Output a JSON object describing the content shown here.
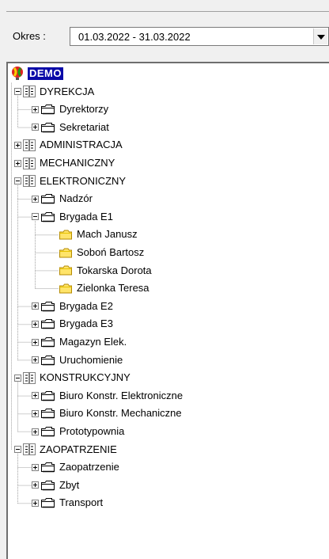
{
  "period": {
    "label": "Okres :",
    "value": "01.03.2022 - 31.03.2022"
  },
  "tree": {
    "root": {
      "label": "DEMO",
      "icon": "balloon-icon"
    },
    "departments": [
      {
        "label": "DYREKCJA",
        "expanded": true,
        "children": [
          {
            "label": "Dyrektorzy"
          },
          {
            "label": "Sekretariat"
          }
        ]
      },
      {
        "label": "ADMINISTRACJA",
        "expanded": false,
        "children": []
      },
      {
        "label": "MECHANICZNY",
        "expanded": false,
        "children": []
      },
      {
        "label": "ELEKTRONICZNY",
        "expanded": true,
        "children": [
          {
            "label": "Nadzór"
          },
          {
            "label": "Brygada E1",
            "expanded": true,
            "people": [
              "Mach Janusz",
              "Soboń Bartosz",
              "Tokarska Dorota",
              "Zielonka Teresa"
            ]
          },
          {
            "label": "Brygada E2"
          },
          {
            "label": "Brygada E3"
          },
          {
            "label": "Magazyn Elek."
          },
          {
            "label": "Uruchomienie"
          }
        ]
      },
      {
        "label": "KONSTRUKCYJNY",
        "expanded": true,
        "children": [
          {
            "label": "Biuro Konstr. Elektroniczne"
          },
          {
            "label": "Biuro Konstr. Mechaniczne"
          },
          {
            "label": "Prototypownia"
          }
        ]
      },
      {
        "label": "ZAOPATRZENIE",
        "expanded": true,
        "children": [
          {
            "label": "Zaopatrzenie"
          },
          {
            "label": "Zbyt"
          },
          {
            "label": "Transport"
          }
        ]
      }
    ]
  }
}
